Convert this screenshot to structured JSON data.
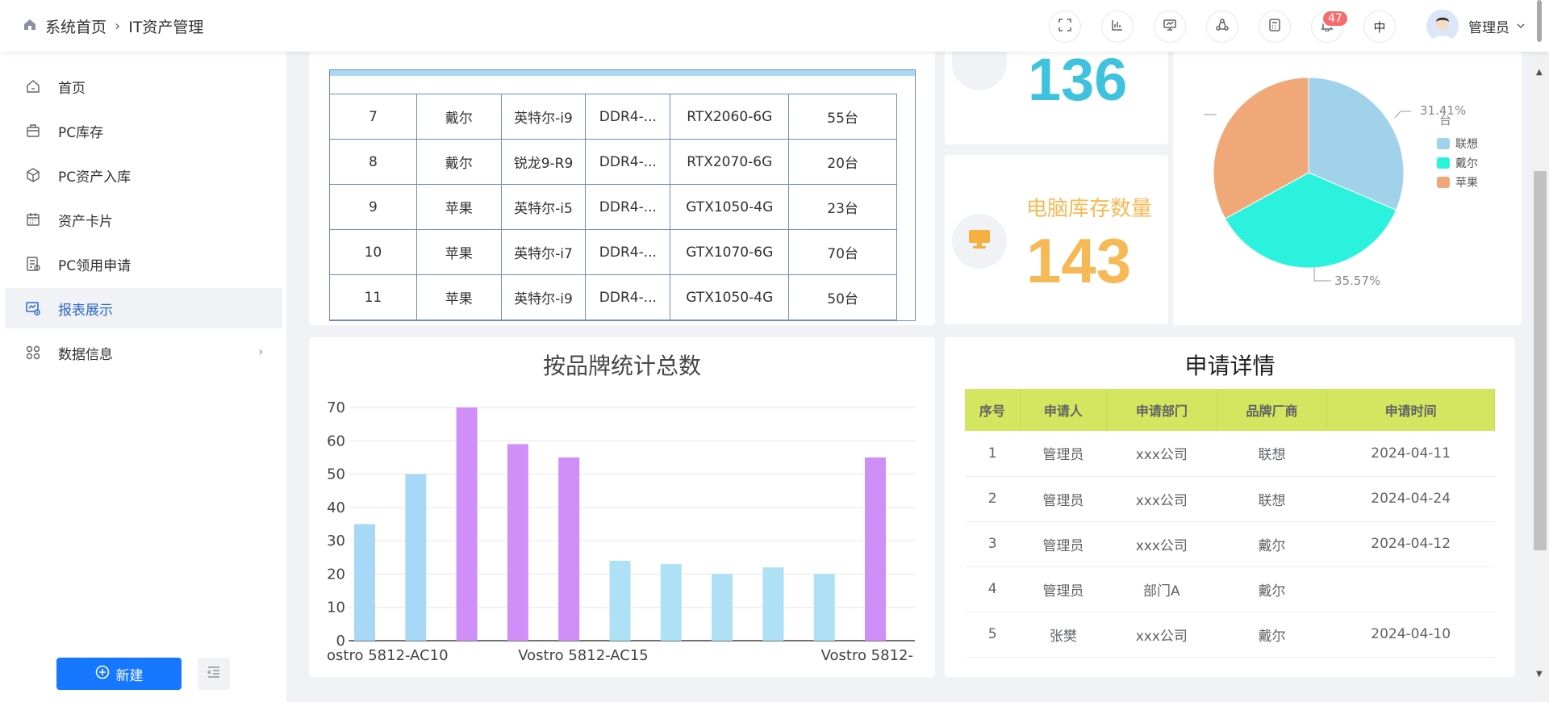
{
  "header": {
    "breadcrumb": [
      "系统首页",
      "IT资产管理"
    ],
    "badge": "47",
    "lang": "中",
    "user": "管理员"
  },
  "sidebar": {
    "items": [
      {
        "label": "首页",
        "icon": "home-icon"
      },
      {
        "label": "PC库存",
        "icon": "briefcase-icon"
      },
      {
        "label": "PC资产入库",
        "icon": "box-icon"
      },
      {
        "label": "资产卡片",
        "icon": "calendar-icon"
      },
      {
        "label": "PC领用申请",
        "icon": "form-icon"
      },
      {
        "label": "报表展示",
        "icon": "chart-screen-icon"
      },
      {
        "label": "数据信息",
        "icon": "grid-icon"
      }
    ],
    "new_label": "新建"
  },
  "inventory": {
    "rows": [
      [
        "7",
        "戴尔",
        "英特尔-i9",
        "DDR4-...",
        "RTX2060-6G",
        "55台"
      ],
      [
        "8",
        "戴尔",
        "锐龙9-R9",
        "DDR4-...",
        "RTX2070-6G",
        "20台"
      ],
      [
        "9",
        "苹果",
        "英特尔-i5",
        "DDR4-...",
        "GTX1050-4G",
        "23台"
      ],
      [
        "10",
        "苹果",
        "英特尔-i7",
        "DDR4-...",
        "GTX1070-6G",
        "70台"
      ],
      [
        "11",
        "苹果",
        "英特尔-i9",
        "DDR4-...",
        "GTX1050-4G",
        "50台"
      ]
    ]
  },
  "stats": {
    "top_value": "136",
    "stock_label": "电脑库存数量",
    "stock_value": "143"
  },
  "pie": {
    "labels": {
      "top": "31.41%",
      "top_unit": "台",
      "bottom": "35.57%"
    },
    "legend": [
      "联想",
      "戴尔",
      "苹果"
    ],
    "colors": [
      "#a0d3ea",
      "#2af2dc",
      "#f0a878"
    ]
  },
  "chart_data": {
    "type": "bar",
    "title": "按品牌统计总数",
    "tick_labels": [
      "ostro 5812-AC10",
      "Vostro 5812-AC15",
      "Vostro 5812-"
    ],
    "values": [
      35,
      50,
      70,
      59,
      55,
      24,
      23,
      20,
      22,
      20,
      55
    ],
    "bar_colors": [
      "#a8d8f8",
      "#a8d8f8",
      "#cf8ef8",
      "#cf8ef8",
      "#cf8ef8",
      "#aee0f6",
      "#aee0f6",
      "#aee0f6",
      "#aee0f6",
      "#aee0f6",
      "#cf8ef8"
    ],
    "yticks": [
      0,
      10,
      20,
      30,
      40,
      50,
      60,
      70
    ],
    "ylim": [
      0,
      70
    ]
  },
  "applications": {
    "title": "申请详情",
    "headers": [
      "序号",
      "申请人",
      "申请部门",
      "品牌厂商",
      "申请时间"
    ],
    "rows": [
      [
        "1",
        "管理员",
        "xxx公司",
        "联想",
        "2024-04-11"
      ],
      [
        "2",
        "管理员",
        "xxx公司",
        "联想",
        "2024-04-24"
      ],
      [
        "3",
        "管理员",
        "xxx公司",
        "戴尔",
        "2024-04-12"
      ],
      [
        "4",
        "管理员",
        "部门A",
        "戴尔",
        ""
      ],
      [
        "5",
        "张樊",
        "xxx公司",
        "戴尔",
        "2024-04-10"
      ]
    ]
  }
}
